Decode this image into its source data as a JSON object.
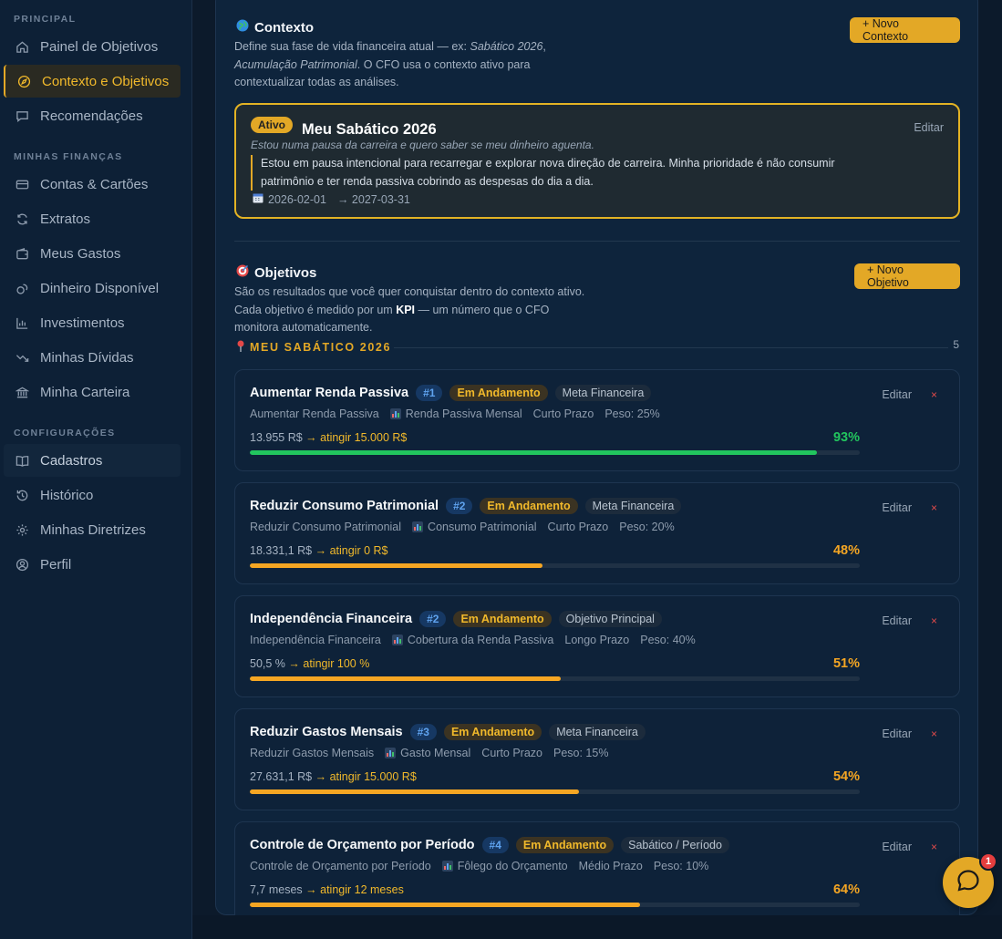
{
  "sidebar": {
    "sections": [
      "PRINCIPAL",
      "MINHAS FINANÇAS",
      "CONFIGURAÇÕES"
    ],
    "items": [
      {
        "label": "Painel de Objetivos",
        "icon": "home-icon"
      },
      {
        "label": "Contexto e Objetivos",
        "icon": "compass-icon"
      },
      {
        "label": "Recomendações",
        "icon": "message-icon"
      },
      {
        "label": "Contas & Cartões",
        "icon": "card-icon"
      },
      {
        "label": "Extratos",
        "icon": "refresh-icon"
      },
      {
        "label": "Meus Gastos",
        "icon": "wallet-icon"
      },
      {
        "label": "Dinheiro Disponível",
        "icon": "coins-icon"
      },
      {
        "label": "Investimentos",
        "icon": "bar-chart-icon"
      },
      {
        "label": "Minhas Dívidas",
        "icon": "trend-down-icon"
      },
      {
        "label": "Minha Carteira",
        "icon": "bank-icon"
      },
      {
        "label": "Cadastros",
        "icon": "book-icon"
      },
      {
        "label": "Histórico",
        "icon": "history-icon"
      },
      {
        "label": "Minhas Diretrizes",
        "icon": "gear-icon"
      },
      {
        "label": "Perfil",
        "icon": "user-icon"
      }
    ]
  },
  "context": {
    "title": "Contexto",
    "desc_pre": "Define sua fase de vida financeira atual — ex: ",
    "desc_ex1": "Sabático 2026",
    "desc_sep": ", ",
    "desc_ex2": "Acumulação Patrimonial",
    "desc_post": ". O CFO usa o contexto ativo para contextualizar todas as análises.",
    "new_button": "+ Novo Contexto",
    "card": {
      "badge": "Ativo",
      "name": "Meu Sabático 2026",
      "subtitle": "Estou numa pausa da carreira e quero saber se meu dinheiro aguenta.",
      "description": "Estou em pausa intencional para recarregar e explorar nova direção de carreira. Minha prioridade é não consumir patrimônio e ter renda passiva cobrindo as despesas do dia a dia.",
      "start": "2026-02-01",
      "end": "→ 2027-03-31",
      "edit": "Editar"
    }
  },
  "objectives": {
    "title": "Objetivos",
    "desc_pre": "São os resultados que você quer conquistar dentro do contexto ativo. Cada objetivo é medido por um ",
    "desc_kpi": "KPI",
    "desc_post": " — um número que o CFO monitora automaticamente.",
    "new_button": "+ Novo Objetivo",
    "group_title": "MEU SABÁTICO 2026",
    "group_count": "5",
    "goals": [
      {
        "name": "Aumentar Renda Passiva",
        "num": "#1",
        "status": "Em Andamento",
        "type": "Meta Financeira",
        "meta_name": "Aumentar Renda Passiva",
        "kpi": "Renda Passiva Mensal",
        "horizon": "Curto Prazo",
        "weight": "Peso: 25%",
        "current": "13.955 R$",
        "target": "→ atingir 15.000 R$",
        "pct_label": "93%",
        "progress": 0.93,
        "color": "#22c55e",
        "edit": "Editar",
        "delete": "×"
      },
      {
        "name": "Reduzir Consumo Patrimonial",
        "num": "#2",
        "status": "Em Andamento",
        "type": "Meta Financeira",
        "meta_name": "Reduzir Consumo Patrimonial",
        "kpi": "Consumo Patrimonial",
        "horizon": "Curto Prazo",
        "weight": "Peso: 20%",
        "current": "18.331,1 R$",
        "target": "→ atingir 0 R$",
        "pct_label": "48%",
        "progress": 0.48,
        "color": "#f5a623",
        "edit": "Editar",
        "delete": "×"
      },
      {
        "name": "Independência Financeira",
        "num": "#2",
        "status": "Em Andamento",
        "type": "Objetivo Principal",
        "meta_name": "Independência Financeira",
        "kpi": "Cobertura da Renda Passiva",
        "horizon": "Longo Prazo",
        "weight": "Peso: 40%",
        "current": "50,5 %",
        "target": "→ atingir 100 %",
        "pct_label": "51%",
        "progress": 0.51,
        "color": "#f5a623",
        "edit": "Editar",
        "delete": "×"
      },
      {
        "name": "Reduzir Gastos Mensais",
        "num": "#3",
        "status": "Em Andamento",
        "type": "Meta Financeira",
        "meta_name": "Reduzir Gastos Mensais",
        "kpi": "Gasto Mensal",
        "horizon": "Curto Prazo",
        "weight": "Peso: 15%",
        "current": "27.631,1 R$",
        "target": "→ atingir 15.000 R$",
        "pct_label": "54%",
        "progress": 0.54,
        "color": "#f5a623",
        "edit": "Editar",
        "delete": "×"
      },
      {
        "name": "Controle de Orçamento por Período",
        "num": "#4",
        "status": "Em Andamento",
        "type": "Sabático / Período",
        "meta_name": "Controle de Orçamento por Período",
        "kpi": "Fôlego do Orçamento",
        "horizon": "Médio Prazo",
        "weight": "Peso: 10%",
        "current": "7,7 meses",
        "target": "→ atingir 12 meses",
        "pct_label": "64%",
        "progress": 0.64,
        "color": "#f5a623",
        "edit": "Editar",
        "delete": "×"
      }
    ]
  },
  "chat": {
    "badge": "1"
  },
  "colors": {
    "accent": "#e3a826",
    "success": "#22c55e",
    "danger": "#e04a4a",
    "info": "#5fa3ef"
  }
}
